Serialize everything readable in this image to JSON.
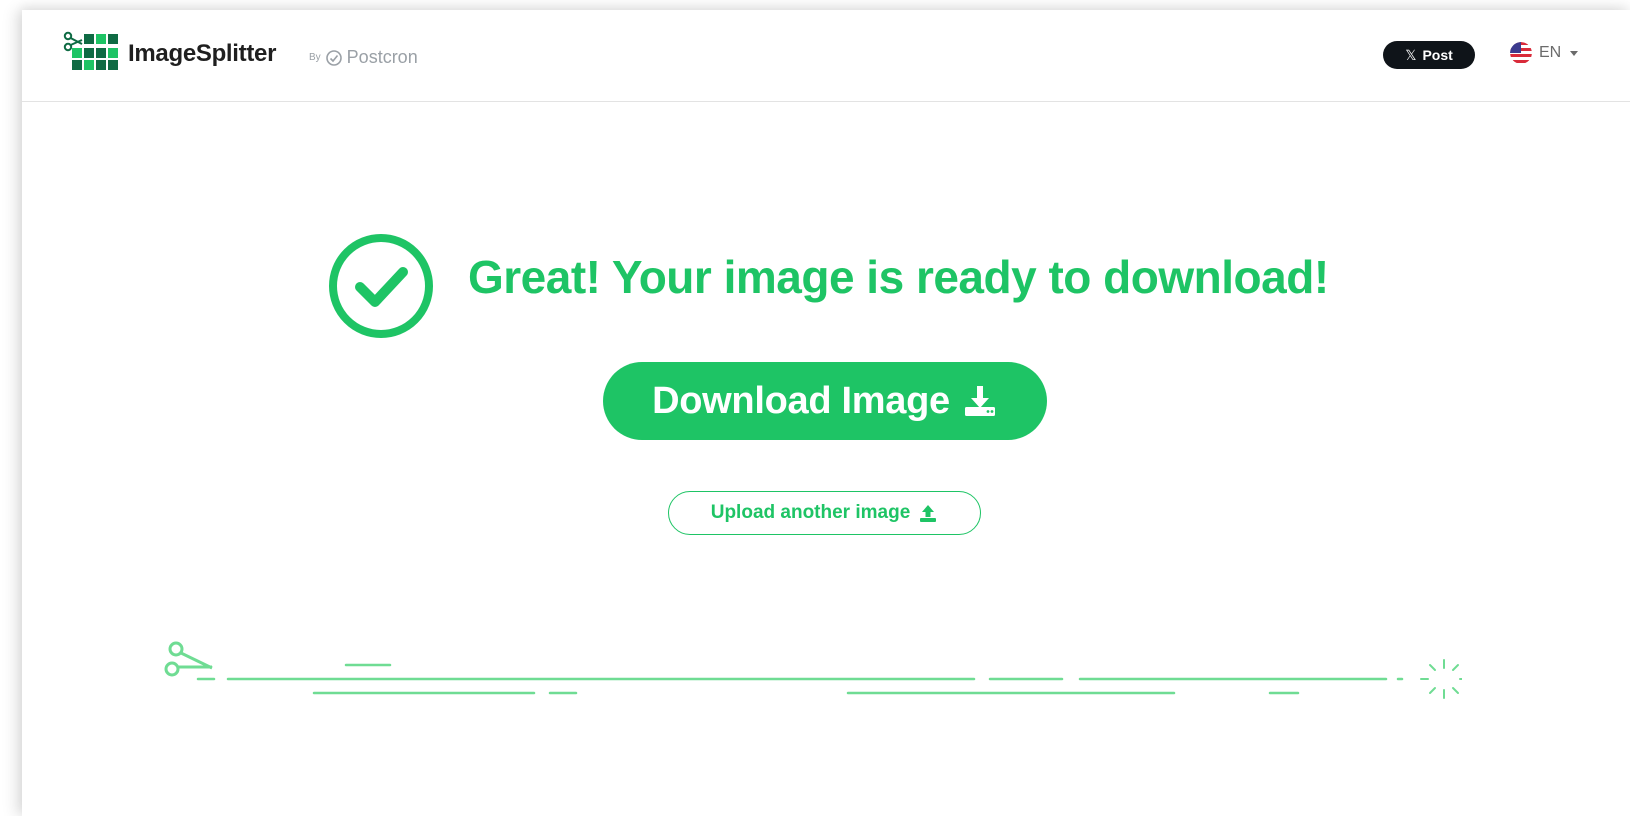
{
  "header": {
    "brand_name": "ImageSplitter",
    "by_label": "By",
    "partner_name": "Postcron",
    "post_button_label": "Post",
    "language_label": "EN"
  },
  "main": {
    "headline": "Great! Your image is ready to download!",
    "download_button_label": "Download Image",
    "upload_button_label": "Upload another image"
  },
  "icons": {
    "logo": "scissors-grid-logo",
    "partner": "postcron-clock-icon",
    "post": "x-icon",
    "language": "us-flag-icon",
    "success": "check-circle-icon",
    "download": "download-icon",
    "upload": "upload-icon",
    "decoration": "scissors-icon"
  },
  "colors": {
    "accent": "#1ec465",
    "dark_green": "#0f6b44",
    "text_dark": "#1f1f1f",
    "muted": "#9aa0a6",
    "post_button": "#0f1419"
  }
}
